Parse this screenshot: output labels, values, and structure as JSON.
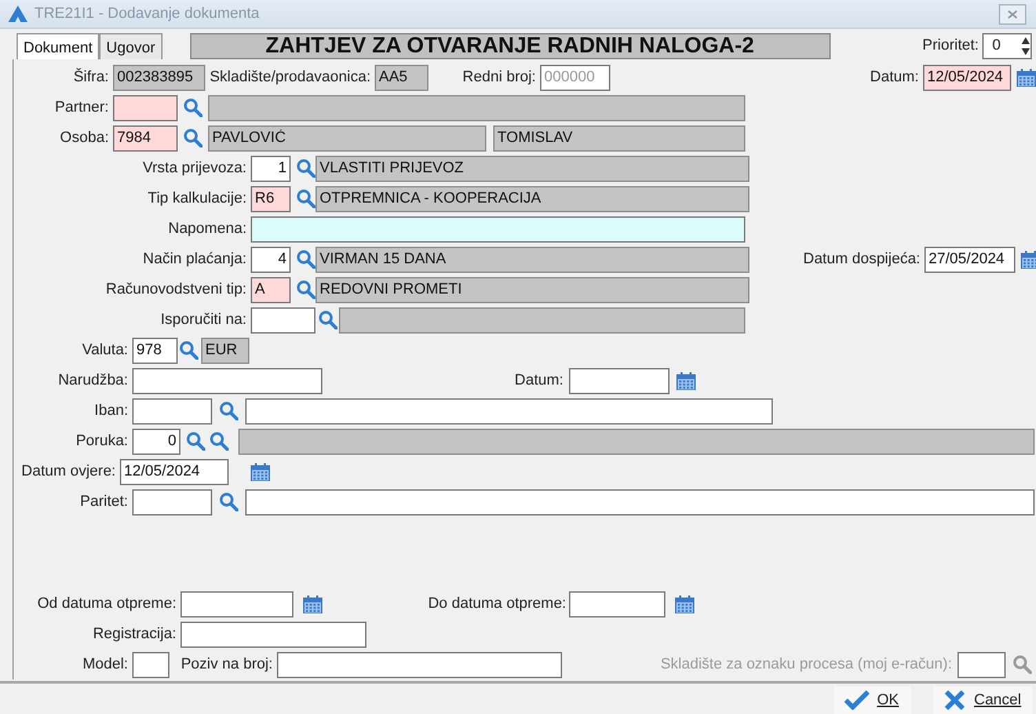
{
  "window": {
    "title": "TRE21I1 - Dodavanje dokumenta"
  },
  "tabs": [
    {
      "label": "Dokument",
      "selected": true
    },
    {
      "label": "Ugovor",
      "selected": false
    }
  ],
  "heading": "ZAHTJEV ZA OTVARANJE RADNIH NALOGA-2",
  "priority": {
    "label": "Prioritet:",
    "value": "0"
  },
  "rows": [
    {
      "items": [
        {
          "kind": "label",
          "text": "Šifra:"
        },
        {
          "kind": "readonly",
          "value": "002383895"
        },
        {
          "kind": "label",
          "text": "Skladište/prodavaonica:"
        },
        {
          "kind": "readonly",
          "value": "AA5"
        },
        {
          "kind": "label",
          "text": "Redni broj:"
        },
        {
          "kind": "input",
          "placeholder": "000000"
        },
        {
          "kind": "label",
          "text": "Datum:"
        },
        {
          "kind": "required",
          "value": "12/05/2024"
        },
        {
          "kind": "calendar"
        }
      ]
    },
    {
      "items": [
        {
          "kind": "label",
          "text": "Partner:"
        },
        {
          "kind": "required"
        },
        {
          "kind": "search"
        },
        {
          "kind": "readonly"
        }
      ]
    },
    {
      "items": [
        {
          "kind": "label",
          "text": "Osoba:"
        },
        {
          "kind": "required",
          "value": "7984"
        },
        {
          "kind": "search"
        },
        {
          "kind": "readonly",
          "value": "PAVLOVIĆ"
        },
        {
          "kind": "readonly",
          "value": "TOMISLAV"
        }
      ]
    },
    {
      "items": [
        {
          "kind": "label",
          "text": "Vrsta prijevoza:"
        },
        {
          "kind": "input",
          "value": "1"
        },
        {
          "kind": "search"
        },
        {
          "kind": "readonly",
          "value": "VLASTITI PRIJEVOZ"
        }
      ]
    },
    {
      "items": [
        {
          "kind": "label",
          "text": "Tip kalkulacije:"
        },
        {
          "kind": "required",
          "value": "R6"
        },
        {
          "kind": "search"
        },
        {
          "kind": "readonly",
          "value": "OTPREMNICA - KOOPERACIJA"
        }
      ]
    },
    {
      "items": [
        {
          "kind": "label",
          "text": "Napomena:"
        },
        {
          "kind": "note"
        }
      ]
    },
    {
      "items": [
        {
          "kind": "label",
          "text": "Način plaćanja:"
        },
        {
          "kind": "input",
          "value": "4"
        },
        {
          "kind": "search"
        },
        {
          "kind": "readonly",
          "value": "VIRMAN 15 DANA"
        },
        {
          "kind": "label",
          "text": "Datum dospijeća:"
        },
        {
          "kind": "input",
          "value": "27/05/2024"
        },
        {
          "kind": "calendar"
        }
      ]
    },
    {
      "items": [
        {
          "kind": "label",
          "text": "Računovodstveni tip:"
        },
        {
          "kind": "required",
          "value": "A"
        },
        {
          "kind": "search"
        },
        {
          "kind": "readonly",
          "value": "REDOVNI PROMETI"
        }
      ]
    },
    {
      "items": [
        {
          "kind": "label",
          "text": "Isporučiti na:"
        },
        {
          "kind": "input"
        },
        {
          "kind": "search"
        },
        {
          "kind": "readonly"
        }
      ]
    },
    {
      "items": [
        {
          "kind": "label",
          "text": "Valuta:"
        },
        {
          "kind": "input",
          "value": "978"
        },
        {
          "kind": "search"
        },
        {
          "kind": "readonly",
          "value": "EUR"
        }
      ]
    },
    {
      "items": [
        {
          "kind": "label",
          "text": "Narudžba:"
        },
        {
          "kind": "input"
        },
        {
          "kind": "label",
          "text": "Datum:"
        },
        {
          "kind": "input"
        },
        {
          "kind": "calendar"
        }
      ]
    },
    {
      "items": [
        {
          "kind": "label",
          "text": "Iban:"
        },
        {
          "kind": "input"
        },
        {
          "kind": "search"
        },
        {
          "kind": "input"
        }
      ]
    },
    {
      "items": [
        {
          "kind": "label",
          "text": "Poruka:"
        },
        {
          "kind": "input",
          "value": "0"
        },
        {
          "kind": "search"
        },
        {
          "kind": "search"
        },
        {
          "kind": "readonly"
        }
      ]
    },
    {
      "items": [
        {
          "kind": "label",
          "text": "Datum ovjere:"
        },
        {
          "kind": "input",
          "value": "12/05/2024"
        },
        {
          "kind": "calendar"
        }
      ]
    },
    {
      "items": [
        {
          "kind": "label",
          "text": "Paritet:"
        },
        {
          "kind": "input"
        },
        {
          "kind": "search"
        },
        {
          "kind": "input"
        }
      ]
    },
    {
      "items": [
        {
          "kind": "label",
          "text": "Od datuma otpreme:"
        },
        {
          "kind": "input"
        },
        {
          "kind": "calendar"
        },
        {
          "kind": "label",
          "text": "Do datuma otpreme:"
        },
        {
          "kind": "input"
        },
        {
          "kind": "calendar"
        }
      ]
    },
    {
      "items": [
        {
          "kind": "label",
          "text": "Registracija:"
        },
        {
          "kind": "input"
        }
      ]
    },
    {
      "items": [
        {
          "kind": "label",
          "text": "Model:",
          "disabled": false
        },
        {
          "kind": "input"
        },
        {
          "kind": "label",
          "text": "Poziv na broj:",
          "disabled": false
        },
        {
          "kind": "input"
        },
        {
          "kind": "label",
          "text": "Skladište za oznaku procesa (moj e-račun):",
          "disabled": true
        },
        {
          "kind": "input"
        },
        {
          "kind": "search",
          "disabled": true
        }
      ]
    }
  ],
  "buttons": [
    {
      "kind": "ok",
      "label": "OK"
    },
    {
      "kind": "cancel",
      "label": "Cancel"
    }
  ]
}
